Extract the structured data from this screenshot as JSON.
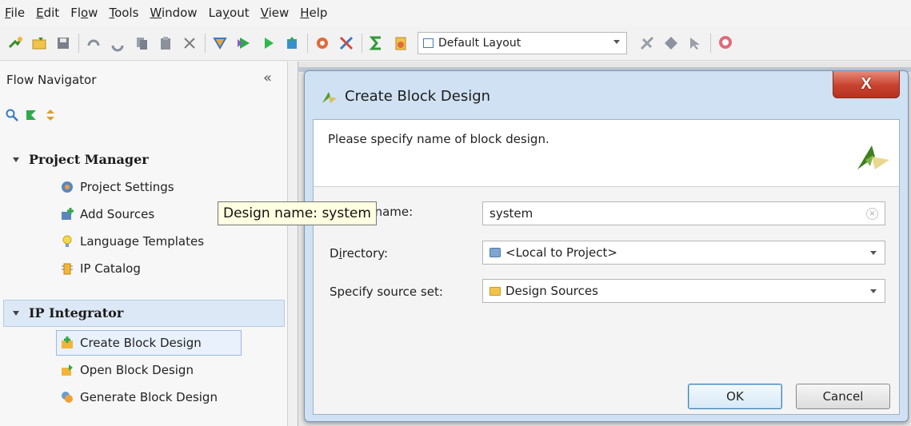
{
  "menu": {
    "items": [
      {
        "pre": "",
        "u": "F",
        "post": "ile"
      },
      {
        "pre": "",
        "u": "E",
        "post": "dit"
      },
      {
        "pre": "Fl",
        "u": "o",
        "post": "w"
      },
      {
        "pre": "",
        "u": "T",
        "post": "ools"
      },
      {
        "pre": "",
        "u": "W",
        "post": "indow"
      },
      {
        "pre": "La",
        "u": "y",
        "post": "out"
      },
      {
        "pre": "",
        "u": "V",
        "post": "iew"
      },
      {
        "pre": "",
        "u": "H",
        "post": "elp"
      }
    ]
  },
  "toolbar": {
    "layout_value": "Default Layout"
  },
  "flow_navigator": {
    "title": "Flow Navigator",
    "collapse_glyph": "«",
    "sections": {
      "project_manager": {
        "label": "Project Manager",
        "items": [
          "Project Settings",
          "Add Sources",
          "Language Templates",
          "IP Catalog"
        ]
      },
      "ip_integrator": {
        "label": "IP Integrator",
        "items": [
          "Create Block Design",
          "Open Block Design",
          "Generate Block Design"
        ]
      }
    }
  },
  "dialog": {
    "title": "Create Block Design",
    "close_label": "X",
    "instruction": "Please specify name of block design.",
    "fields": {
      "design_name": {
        "label_u": "D",
        "label_rest": "esign name:",
        "value": "system"
      },
      "directory": {
        "label_pre": "D",
        "label_u": "i",
        "label_rest": "rectory:",
        "value": "<Local to Project>"
      },
      "source_set": {
        "label": "Specify source set:",
        "value": "Design Sources"
      }
    },
    "tooltip": "Design name: system",
    "ok_label": "OK",
    "cancel_label": "Cancel"
  },
  "colors": {
    "dialog_frame": "#cfe1f2",
    "close_button": "#c7422f",
    "selection": "#dde8f6",
    "tooltip_bg": "#ffffe1"
  }
}
